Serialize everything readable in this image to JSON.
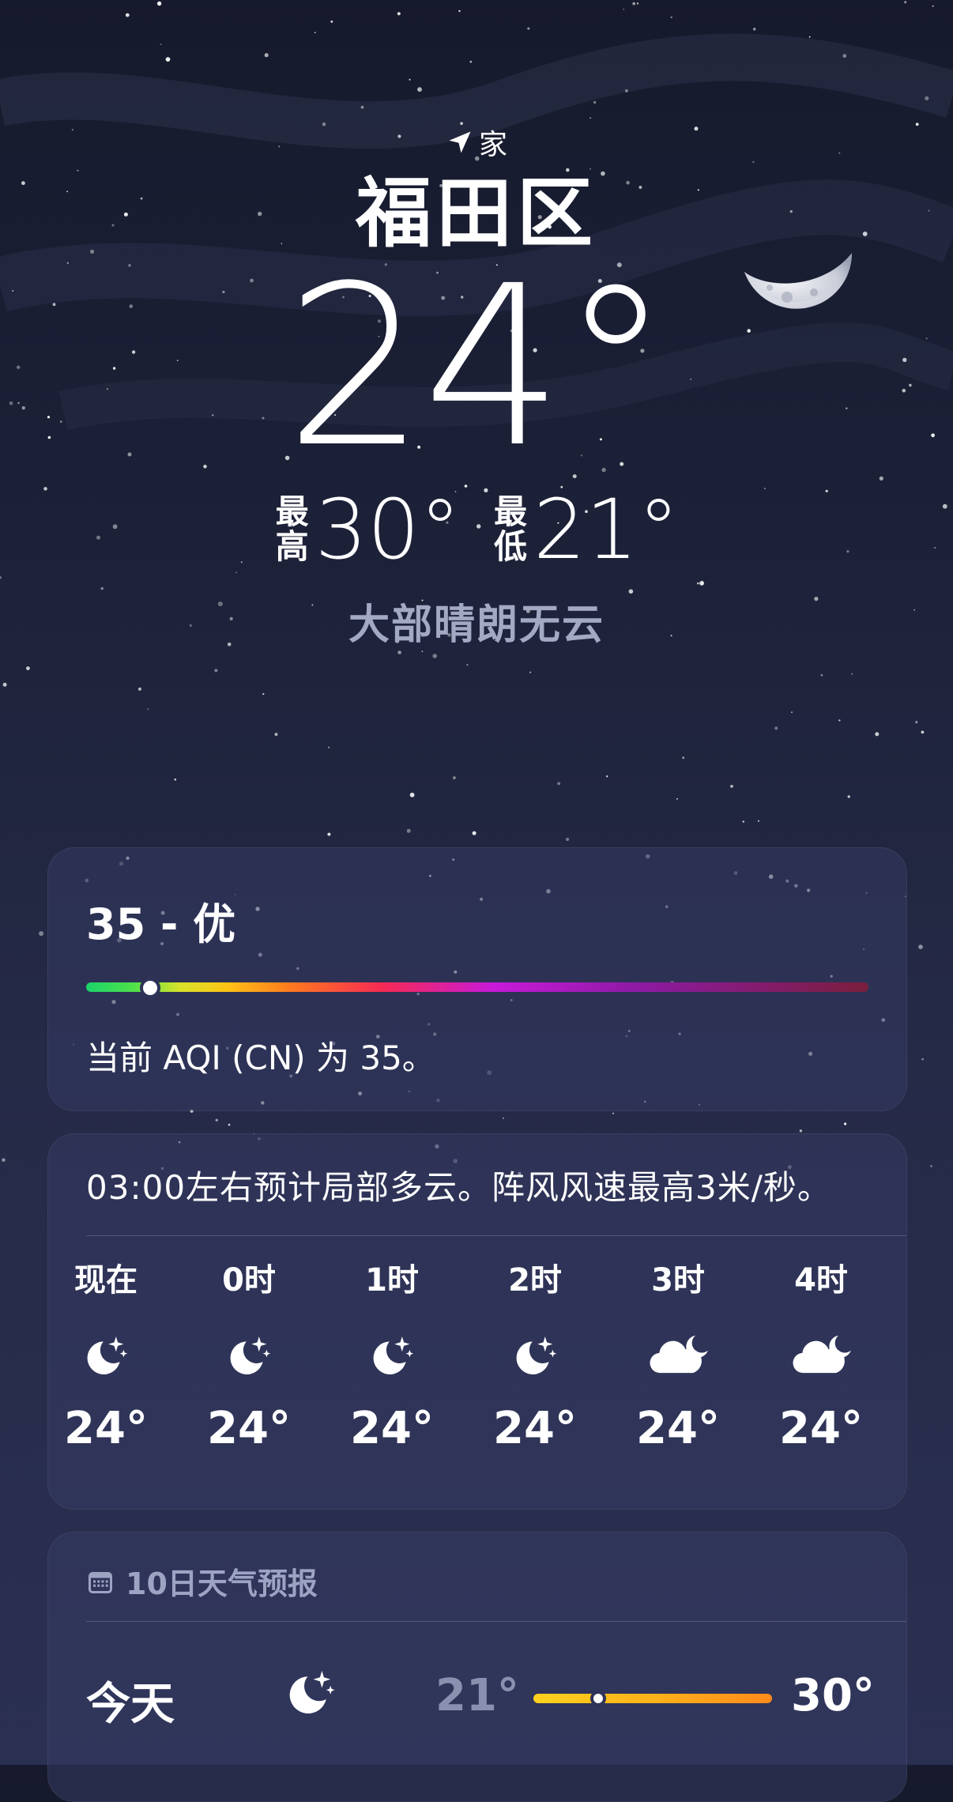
{
  "location": {
    "label": "家",
    "city": "福田区"
  },
  "current": {
    "temp": "24°",
    "hi_label": "最高",
    "hi": "30°",
    "lo_label": "最低",
    "lo": "21°",
    "condition": "大部晴朗无云"
  },
  "aqi": {
    "title": "35 - 优",
    "value": 35,
    "description": "当前 AQI (CN) 为 35。"
  },
  "hourly": {
    "summary": "03:00左右预计局部多云。阵风风速最高3米/秒。",
    "items": [
      {
        "label": "现在",
        "icon": "moon-stars-icon",
        "temp": "24°"
      },
      {
        "label": "0时",
        "icon": "moon-stars-icon",
        "temp": "24°"
      },
      {
        "label": "1时",
        "icon": "moon-stars-icon",
        "temp": "24°"
      },
      {
        "label": "2时",
        "icon": "moon-stars-icon",
        "temp": "24°"
      },
      {
        "label": "3时",
        "icon": "cloud-moon-icon",
        "temp": "24°"
      },
      {
        "label": "4时",
        "icon": "cloud-moon-icon",
        "temp": "24°"
      }
    ]
  },
  "daily": {
    "title": "10日天气预报",
    "today": {
      "label": "今天",
      "icon": "moon-stars-icon",
      "lo": "21°",
      "hi": "30°"
    }
  }
}
